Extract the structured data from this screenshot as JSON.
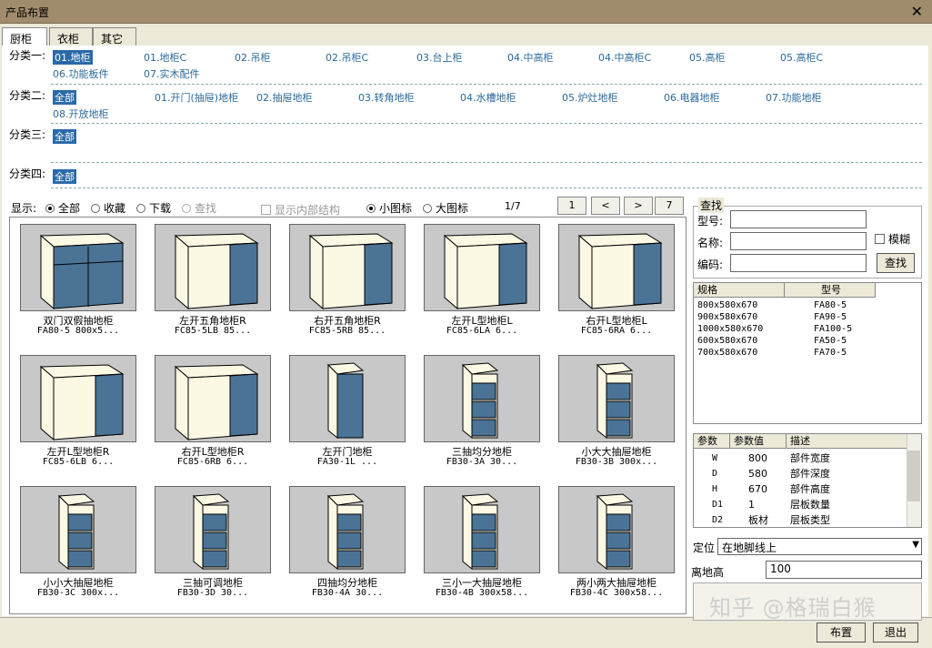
{
  "window": {
    "title": "产品布置"
  },
  "tabs": [
    {
      "label": "厨柜"
    },
    {
      "label": "衣柜"
    },
    {
      "label": "其它"
    }
  ],
  "categories": {
    "row1": {
      "label": "分类一:",
      "items": [
        "01.地柜",
        "01.地柜C",
        "02.吊柜",
        "02.吊柜C",
        "03.台上柜",
        "04.中高柜",
        "04.中高柜C",
        "05.高柜",
        "05.高柜C",
        "06.功能板件",
        "07.实木配件"
      ]
    },
    "row2": {
      "label": "分类二:",
      "items": [
        "全部",
        "01.开门(抽屉)地柜",
        "02.抽屉地柜",
        "03.转角地柜",
        "04.水槽地柜",
        "05.炉灶地柜",
        "06.电器地柜",
        "07.功能地柜",
        "08.开放地柜"
      ]
    },
    "row3": {
      "label": "分类三:",
      "items": [
        "全部"
      ]
    },
    "row4": {
      "label": "分类四:",
      "items": [
        "全部"
      ]
    }
  },
  "display": {
    "label": "显示:",
    "all": "全部",
    "fav": "收藏",
    "download": "下载",
    "search": "查找",
    "inner": "显示内部结构",
    "small": "小图标",
    "large": "大图标",
    "page": "1/7",
    "first": "1",
    "prev": "<",
    "next": ">",
    "last": "7"
  },
  "products": [
    {
      "name": "双门双假抽地柜",
      "code": "FA80-5 800x5..."
    },
    {
      "name": "左开五角地柜R",
      "code": "FC85-5LB 85..."
    },
    {
      "name": "右开五角地柜R",
      "code": "FC85-5RB 85..."
    },
    {
      "name": "左开L型地柜L",
      "code": "FC85-6LA 6..."
    },
    {
      "name": "右开L型地柜L",
      "code": "FC85-6RA 6..."
    },
    {
      "name": "左开L型地柜R",
      "code": "FC85-6LB 6..."
    },
    {
      "name": "右开L型地柜R",
      "code": "FC85-6RB 6..."
    },
    {
      "name": "左开门地柜",
      "code": "FA30-1L ..."
    },
    {
      "name": "三抽均分地柜",
      "code": "FB30-3A 30..."
    },
    {
      "name": "小大大抽屉地柜",
      "code": "FB30-3B 300x..."
    },
    {
      "name": "小小大抽屉地柜",
      "code": "FB30-3C 300x..."
    },
    {
      "name": "三抽可调地柜",
      "code": "FB30-3D 30..."
    },
    {
      "name": "四抽均分地柜",
      "code": "FB30-4A 30..."
    },
    {
      "name": "三小一大抽屉地柜",
      "code": "FB30-4B 300x58..."
    },
    {
      "name": "两小两大抽屉地柜",
      "code": "FB30-4C 300x58..."
    }
  ],
  "search": {
    "group": "查找",
    "model_label": "型号:",
    "name_label": "名称:",
    "code_label": "编码:",
    "fuzzy": "模糊",
    "button": "查找"
  },
  "spec_table": {
    "headers": [
      "规格",
      "型号"
    ],
    "rows": [
      [
        "800x580x670",
        "FA80-5"
      ],
      [
        "900x580x670",
        "FA90-5"
      ],
      [
        "1000x580x670",
        "FA100-5"
      ],
      [
        "600x580x670",
        "FA50-5"
      ],
      [
        "700x580x670",
        "FA70-5"
      ]
    ]
  },
  "param_table": {
    "headers": [
      "参数",
      "参数值",
      "描述"
    ],
    "rows": [
      [
        "W",
        "800",
        "部件宽度"
      ],
      [
        "D",
        "580",
        "部件深度"
      ],
      [
        "H",
        "670",
        "部件高度"
      ],
      [
        "D1",
        "1",
        "层板数量"
      ],
      [
        "D2",
        "板材",
        "层板类型"
      ]
    ]
  },
  "position": {
    "label": "定位",
    "value": "在地脚线上"
  },
  "height": {
    "label": "离地高",
    "value": "100"
  },
  "footer": {
    "place": "布置",
    "exit": "退出"
  },
  "watermark": "知乎 @格瑞白猴",
  "colors": {
    "door": "#4a7396",
    "body": "#fbf8e4",
    "selected": "#2a6aa8"
  }
}
